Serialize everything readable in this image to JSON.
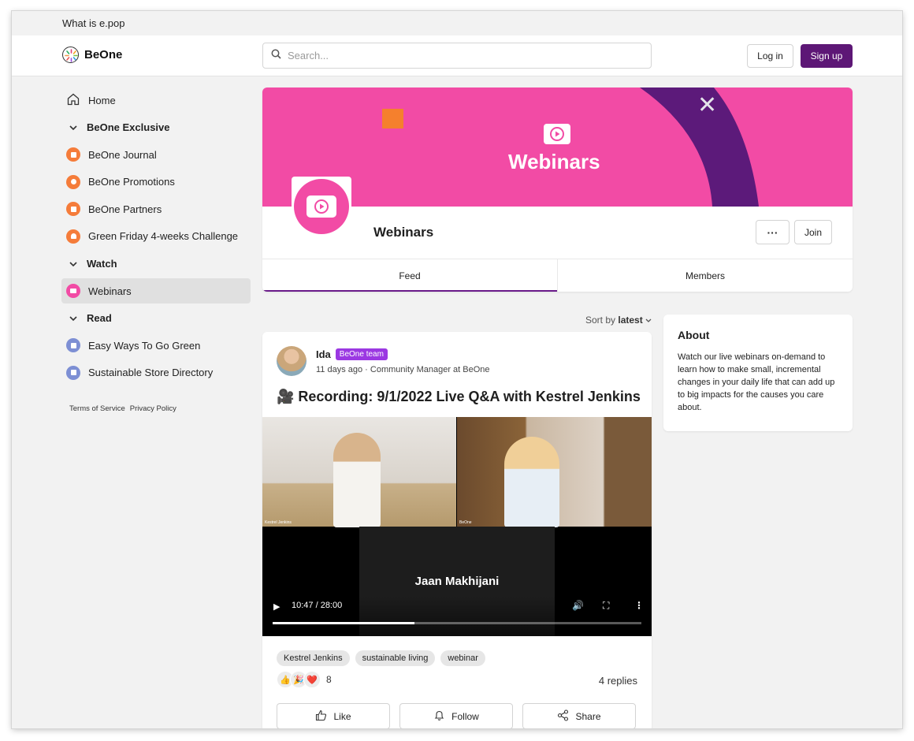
{
  "topbar": {
    "link": "What is e.pop"
  },
  "header": {
    "logo_text": "BeOne",
    "search_placeholder": "Search...",
    "login_label": "Log in",
    "signup_label": "Sign up"
  },
  "sidebar": {
    "home": "Home",
    "sections": [
      {
        "title": "BeOne Exclusive",
        "items": [
          {
            "label": "BeOne Journal",
            "icon": "book-icon",
            "color": "#f57c3a"
          },
          {
            "label": "BeOne Promotions",
            "icon": "tag-icon",
            "color": "#f57c3a"
          },
          {
            "label": "BeOne Partners",
            "icon": "store-icon",
            "color": "#f57c3a"
          },
          {
            "label": "Green Friday 4-weeks Challenge",
            "icon": "trophy-icon",
            "color": "#f57c3a"
          }
        ]
      },
      {
        "title": "Watch",
        "items": [
          {
            "label": "Webinars",
            "icon": "play-icon",
            "color": "#f24ba5"
          }
        ]
      },
      {
        "title": "Read",
        "items": [
          {
            "label": "Easy Ways To Go Green",
            "icon": "book-icon",
            "color": "#7d8fd4"
          },
          {
            "label": "Sustainable Store Directory",
            "icon": "directory-icon",
            "color": "#7d8fd4"
          }
        ]
      }
    ],
    "legal": {
      "terms": "Terms of Service",
      "privacy": "Privacy Policy"
    }
  },
  "group": {
    "banner_title": "Webinars",
    "name": "Webinars",
    "more_label": "···",
    "join_label": "Join",
    "tabs": [
      {
        "label": "Feed"
      },
      {
        "label": "Members"
      }
    ],
    "colors": {
      "banner": "#f24ba5",
      "arc": "#5c1a7a",
      "accent": "#6a1b8a"
    }
  },
  "sort": {
    "prefix": "Sort by",
    "value": "latest"
  },
  "post": {
    "author": "Ida",
    "badge": "BeOne team",
    "meta": "11 days ago · Community Manager at BeOne",
    "title": "🎥 Recording: 9/1/2022 Live Q&A with Kestrel Jenkins",
    "video": {
      "speaker": "Jaan Makhijani",
      "time": "10:47 / 28:00",
      "progress": 0.385,
      "cam_left_label": "Kestrel Jenkins",
      "cam_right_label": "BeOne"
    },
    "tags": [
      "Kestrel Jenkins",
      "sustainable living",
      "webinar"
    ],
    "reactions": [
      "👍",
      "🎉",
      "❤️"
    ],
    "reaction_count": "8",
    "replies": "4 replies",
    "actions": {
      "like": "Like",
      "follow": "Follow",
      "share": "Share"
    }
  },
  "about": {
    "title": "About",
    "text": "Watch our live webinars on-demand to learn how to make small, incremental changes in your daily life that can add up to big impacts for the causes you care about."
  }
}
